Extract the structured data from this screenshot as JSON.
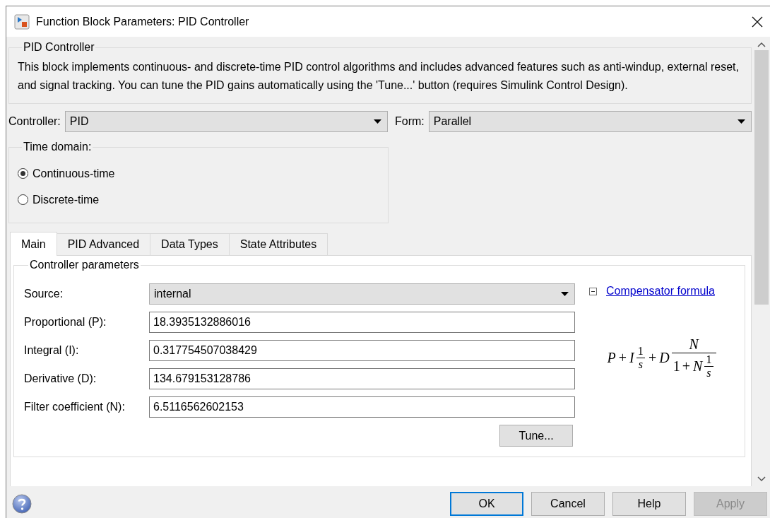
{
  "window": {
    "title": "Function Block Parameters: PID Controller"
  },
  "description_group": {
    "title": "PID Controller",
    "text": "This block implements continuous- and discrete-time PID control algorithms and includes advanced features such as anti-windup, external reset, and signal tracking. You can tune the PID gains automatically using the 'Tune...' button (requires Simulink Control Design)."
  },
  "controller": {
    "label": "Controller:",
    "value": "PID"
  },
  "form": {
    "label": "Form:",
    "value": "Parallel"
  },
  "time_domain": {
    "title": "Time domain:",
    "options": [
      {
        "label": "Continuous-time",
        "selected": true
      },
      {
        "label": "Discrete-time",
        "selected": false
      }
    ]
  },
  "tabs": [
    {
      "label": "Main",
      "selected": true
    },
    {
      "label": "PID Advanced",
      "selected": false
    },
    {
      "label": "Data Types",
      "selected": false
    },
    {
      "label": "State Attributes",
      "selected": false
    }
  ],
  "controller_parameters": {
    "title": "Controller parameters",
    "source": {
      "label": "Source:",
      "value": "internal"
    },
    "fields": [
      {
        "label": "Proportional (P):",
        "value": "18.3935132886016"
      },
      {
        "label": "Integral (I):",
        "value": "0.317754507038429"
      },
      {
        "label": "Derivative (D):",
        "value": "134.679153128786"
      },
      {
        "label": "Filter coefficient (N):",
        "value": "6.5116562602153"
      }
    ],
    "tune_button": "Tune...",
    "formula_toggle": {
      "label": "Compensator formula",
      "expanded": true
    },
    "formula": [
      {
        "kind": "var",
        "text": "P"
      },
      {
        "kind": "op",
        "text": "+"
      },
      {
        "kind": "var",
        "text": "I"
      },
      {
        "kind": "frac",
        "num": [
          {
            "kind": "num",
            "text": "1"
          }
        ],
        "den": [
          {
            "kind": "var",
            "text": "s"
          }
        ]
      },
      {
        "kind": "op",
        "text": "+"
      },
      {
        "kind": "var",
        "text": "D"
      },
      {
        "kind": "frac",
        "num": [
          {
            "kind": "var",
            "text": "N"
          }
        ],
        "den": [
          {
            "kind": "num",
            "text": "1"
          },
          {
            "kind": "op",
            "text": "+"
          },
          {
            "kind": "var",
            "text": "N"
          },
          {
            "kind": "frac",
            "num": [
              {
                "kind": "num",
                "text": "1"
              }
            ],
            "den": [
              {
                "kind": "var",
                "text": "s"
              }
            ]
          }
        ]
      }
    ]
  },
  "buttons": [
    {
      "label": "OK",
      "default": true,
      "disabled": false
    },
    {
      "label": "Cancel",
      "default": false,
      "disabled": false
    },
    {
      "label": "Help",
      "default": false,
      "disabled": false
    },
    {
      "label": "Apply",
      "default": false,
      "disabled": true
    }
  ]
}
